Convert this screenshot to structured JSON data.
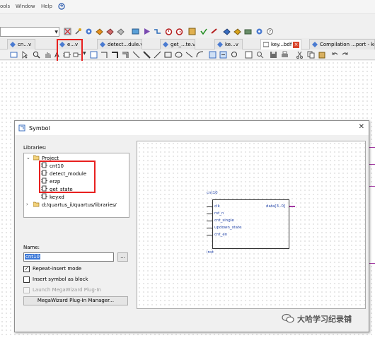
{
  "menubar": {
    "items": [
      "ools",
      "Window",
      "Help"
    ]
  },
  "tabs": [
    {
      "label": "cn...v",
      "icon": "diamond-icon"
    },
    {
      "label": "e...v",
      "icon": "diamond-icon"
    },
    {
      "label": "detect...dule.v",
      "icon": "diamond-icon"
    },
    {
      "label": "get_...te.v",
      "icon": "diamond-icon"
    },
    {
      "label": "ke...v",
      "icon": "diamond-icon"
    },
    {
      "label": "key...bdf",
      "icon": "bdf-icon",
      "close": "×"
    },
    {
      "label": "Compilation ...port - keyxd",
      "icon": "diamond-icon"
    }
  ],
  "dialog": {
    "title": "Symbol",
    "close": "✕",
    "libraries_label": "Libraries:",
    "tree": {
      "project_label": "Project",
      "items": [
        "cnt10",
        "detect_module",
        "erzp",
        "get_state",
        "keyxd"
      ],
      "library_path": "d:/quartus_ii/quartus/libraries/"
    },
    "name_label": "Name:",
    "name_value": "cnt10",
    "browse_label": "...",
    "repeat_insert": {
      "label": "Repeat-insert mode",
      "checked": true
    },
    "insert_block": {
      "label": "Insert symbol as block",
      "checked": false
    },
    "launch_mega": {
      "label": "Launch MegaWizard Plug-In",
      "checked": false
    },
    "mega_button": "MegaWizard Plug-In Manager...",
    "symbol": {
      "name": "cnt10",
      "inputs": [
        "clk",
        "rst_n",
        "cnt_single",
        "updown_state",
        "cnt_en"
      ],
      "output": "data[3..0]",
      "instance": "inst"
    }
  },
  "watermark": {
    "text": "大哈学习纪录铺"
  },
  "colors": {
    "highlight_red": "#e8201f",
    "selection_blue": "#3b78d8",
    "output_pin_purple": "#a237a2"
  }
}
